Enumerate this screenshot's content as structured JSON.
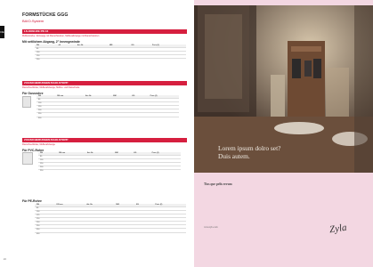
{
  "left_page": {
    "title": "FORMSTÜCKE GGG",
    "subtitle": "BAIO-System",
    "side_tab": "DE",
    "page_number": "24",
    "sections": [
      {
        "bar": "LS-KREUZE PN 16",
        "red_text": "Muffenstücke / Abzweige mit Flanschstutzen, Muffenabzweige mit Flanschstutzen",
        "heading": "Mit seitlichem Abgang, 2\" Innengewinde",
        "columns": [
          "DN",
          "d2",
          "Art.-Nr.",
          "MM",
          "KG",
          "Preis (€)"
        ],
        "rows": [
          [
            "80",
            "",
            "",
            "",
            "",
            ""
          ],
          [
            "100",
            "",
            "",
            "",
            "",
            ""
          ],
          [
            "150",
            "",
            "",
            "",
            "",
            ""
          ],
          [
            "200",
            "",
            "",
            "",
            "",
            ""
          ]
        ]
      },
      {
        "bar": "ZUGSICHERUNGEN BAIO-STOPP",
        "red_text": "Flanschverbinder, Muffenabzweige, Muffen- und Flanschteile",
        "heading": "Für Gussrohre",
        "small": "",
        "columns": [
          "DN",
          "DN mm",
          "Art.-Nr.",
          "MM",
          "KG",
          "Preis (€)"
        ],
        "rows": [
          [
            "80",
            "",
            "",
            "",
            "",
            ""
          ],
          [
            "100",
            "",
            "",
            "",
            "",
            ""
          ],
          [
            "150",
            "",
            "",
            "",
            "",
            ""
          ],
          [
            "200",
            "",
            "",
            "",
            "",
            ""
          ],
          [
            "250",
            "",
            "",
            "",
            "",
            ""
          ],
          [
            "300",
            "",
            "",
            "",
            "",
            ""
          ]
        ]
      },
      {
        "bar": "ZUGSICHERUNGEN BAIO-STOPP",
        "red_text": "Flanschverbinder, Muffenabzweige",
        "heading": "Für PVC-Rohre",
        "small": "",
        "columns": [
          "DN",
          "DN mm",
          "Art.-Nr.",
          "MM",
          "KG",
          "Preis (€)"
        ],
        "rows": [
          [
            "80",
            "",
            "",
            "",
            "",
            ""
          ],
          [
            "100",
            "",
            "",
            "",
            "",
            ""
          ],
          [
            "150",
            "",
            "",
            "",
            "",
            ""
          ],
          [
            "200",
            "",
            "",
            "",
            "",
            ""
          ],
          [
            "250",
            "",
            "",
            "",
            "",
            ""
          ]
        ]
      },
      {
        "heading": "Für PE-Rohre",
        "small": "",
        "columns": [
          "DN",
          "DN mm",
          "Art.-Nr.",
          "MM",
          "KG",
          "Preis (€)"
        ],
        "rows": [
          [
            "80",
            "",
            "",
            "",
            "",
            ""
          ],
          [
            "100",
            "",
            "",
            "",
            "",
            ""
          ],
          [
            "125",
            "",
            "",
            "",
            "",
            ""
          ],
          [
            "150",
            "",
            "",
            "",
            "",
            ""
          ],
          [
            "200",
            "",
            "",
            "",
            "",
            ""
          ],
          [
            "250",
            "",
            "",
            "",
            "",
            ""
          ],
          [
            "300",
            "",
            "",
            "",
            "",
            ""
          ],
          [
            "400",
            "",
            "",
            "",
            "",
            ""
          ]
        ]
      }
    ],
    "footer": ""
  },
  "right_page": {
    "caption_line1": "Lorem ipsum dolro set?",
    "caption_line2": "Duis autem.",
    "text_heading": "Tios que pelis errum",
    "text_body": "",
    "website": "www.zyla.com",
    "signature": "Zyla",
    "colors": {
      "background": "#f3d7e2",
      "accent": "#d61f3f"
    }
  }
}
